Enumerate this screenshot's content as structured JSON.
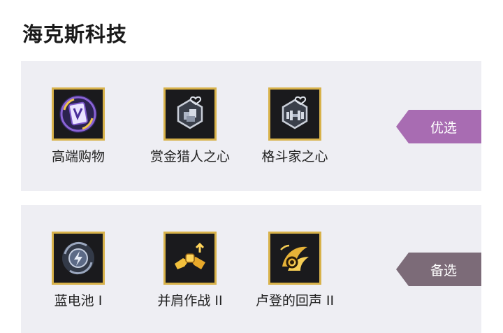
{
  "title": "海克斯科技",
  "groups": [
    {
      "tag": "优选",
      "augments": [
        {
          "name": "高端购物",
          "icon": "shopping-card-icon"
        },
        {
          "name": "赏金猎人之心",
          "icon": "bounty-heart-icon"
        },
        {
          "name": "格斗家之心",
          "icon": "brawler-heart-icon"
        }
      ]
    },
    {
      "tag": "备选",
      "augments": [
        {
          "name": "蓝电池 I",
          "icon": "blue-battery-icon"
        },
        {
          "name": "并肩作战 II",
          "icon": "fist-bump-icon"
        },
        {
          "name": "卢登的回声 II",
          "icon": "ludens-echo-icon"
        }
      ]
    }
  ],
  "colors": {
    "frame_gold": "#d8b24a",
    "tag_preferred": "#a86cb2",
    "tag_alternate": "#7c6b78",
    "panel_bg": "#eeeef3"
  }
}
